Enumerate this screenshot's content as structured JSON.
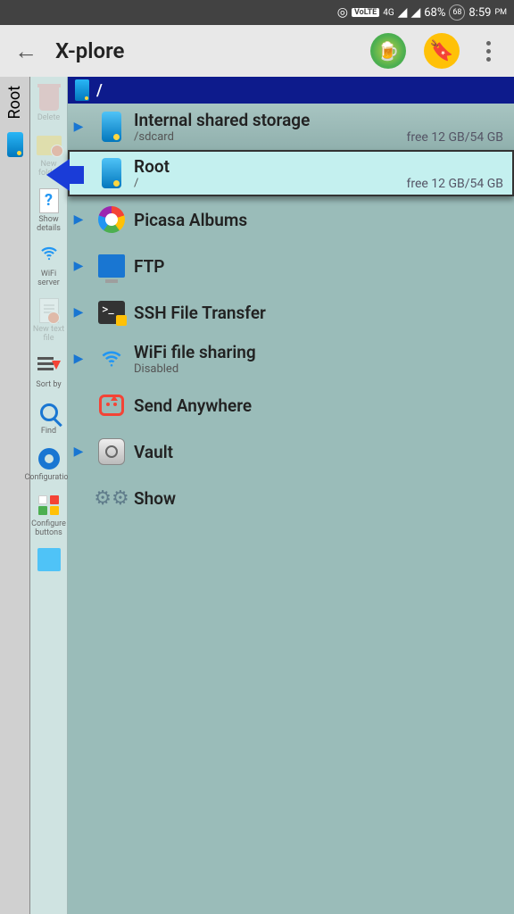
{
  "statusbar": {
    "volte": "VoLTE",
    "net": "4G",
    "battery": "68%",
    "time": "8:59",
    "ampm": "PM",
    "circle": "68"
  },
  "appbar": {
    "title": "X-plore"
  },
  "vtab": {
    "label": "Root"
  },
  "sidebar": [
    {
      "label": "Delete",
      "icon": "trash",
      "dim": true
    },
    {
      "label": "New folder",
      "icon": "folder",
      "dim": true
    },
    {
      "label": "Show details",
      "icon": "doc",
      "dim": false
    },
    {
      "label": "WiFi server",
      "icon": "wifi",
      "dim": false
    },
    {
      "label": "New text file",
      "icon": "textfile",
      "dim": true
    },
    {
      "label": "Sort by",
      "icon": "sortby",
      "dim": false
    },
    {
      "label": "Find",
      "icon": "magnify",
      "dim": false
    },
    {
      "label": "Configuration",
      "icon": "gear",
      "dim": false
    },
    {
      "label": "Configure buttons",
      "icon": "cfgbtn",
      "dim": false
    },
    {
      "label": "",
      "icon": "blank",
      "dim": false
    }
  ],
  "path": "/",
  "items": [
    {
      "name": "Internal shared storage",
      "sub": "/sdcard",
      "info": "free 12 GB/54 GB",
      "icon": "phone",
      "exp": true,
      "cls": "shade"
    },
    {
      "name": "Root",
      "sub": "/",
      "info": "free 12 GB/54 GB",
      "icon": "phone",
      "exp": true,
      "cls": "selected"
    },
    {
      "name": "Picasa Albums",
      "sub": "",
      "info": "",
      "icon": "picasa",
      "exp": true,
      "cls": ""
    },
    {
      "name": "FTP",
      "sub": "",
      "info": "",
      "icon": "ftp",
      "exp": true,
      "cls": ""
    },
    {
      "name": "SSH File Transfer",
      "sub": "",
      "info": "",
      "icon": "ssh",
      "exp": true,
      "cls": ""
    },
    {
      "name": "WiFi file sharing",
      "sub": "Disabled",
      "info": "",
      "icon": "wifi",
      "exp": true,
      "cls": ""
    },
    {
      "name": "Send Anywhere",
      "sub": "",
      "info": "",
      "icon": "send",
      "exp": false,
      "cls": ""
    },
    {
      "name": "Vault",
      "sub": "",
      "info": "",
      "icon": "vault",
      "exp": true,
      "cls": ""
    },
    {
      "name": "Show",
      "sub": "",
      "info": "",
      "icon": "show",
      "exp": false,
      "cls": ""
    }
  ]
}
